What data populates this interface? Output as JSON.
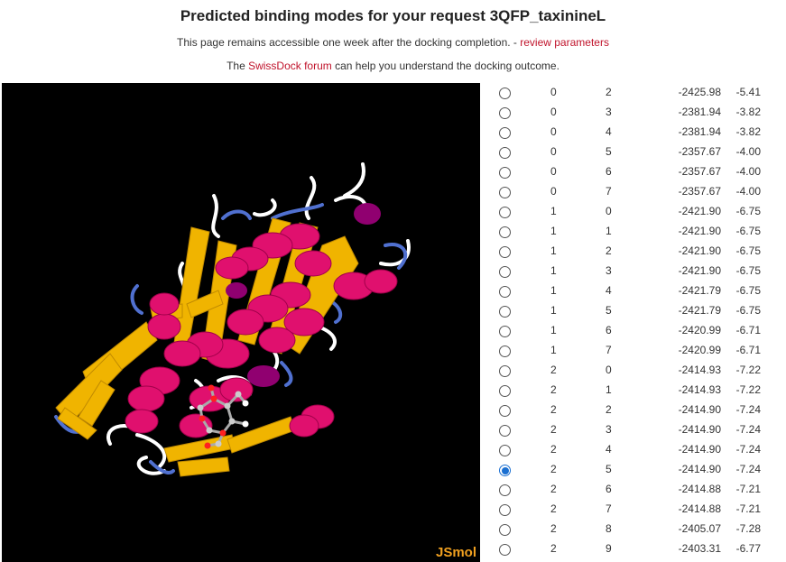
{
  "header": {
    "title": "Predicted binding modes for your request 3QFP_taxinineL",
    "line1_text": "This page remains accessible one week after the docking completion. - ",
    "line1_link": "review parameters",
    "line2_prefix": "The ",
    "line2_link": "SwissDock forum",
    "line2_suffix": " can help you understand the docking outcome."
  },
  "viewer": {
    "label": "JSmol",
    "label_color": "#f0a020",
    "background": "#000000"
  },
  "colors": {
    "link": "#c0132b",
    "helix": "#e0106e",
    "sheet": "#f0b400",
    "coil": "#ffffff",
    "turn": "#5070d0",
    "radio_checked": "#1a6fd1"
  },
  "results": [
    {
      "cluster": "0",
      "element": "2",
      "fitness": "-2425.98",
      "dg": "-5.41",
      "selected": false
    },
    {
      "cluster": "0",
      "element": "3",
      "fitness": "-2381.94",
      "dg": "-3.82",
      "selected": false
    },
    {
      "cluster": "0",
      "element": "4",
      "fitness": "-2381.94",
      "dg": "-3.82",
      "selected": false
    },
    {
      "cluster": "0",
      "element": "5",
      "fitness": "-2357.67",
      "dg": "-4.00",
      "selected": false
    },
    {
      "cluster": "0",
      "element": "6",
      "fitness": "-2357.67",
      "dg": "-4.00",
      "selected": false
    },
    {
      "cluster": "0",
      "element": "7",
      "fitness": "-2357.67",
      "dg": "-4.00",
      "selected": false
    },
    {
      "cluster": "1",
      "element": "0",
      "fitness": "-2421.90",
      "dg": "-6.75",
      "selected": false
    },
    {
      "cluster": "1",
      "element": "1",
      "fitness": "-2421.90",
      "dg": "-6.75",
      "selected": false
    },
    {
      "cluster": "1",
      "element": "2",
      "fitness": "-2421.90",
      "dg": "-6.75",
      "selected": false
    },
    {
      "cluster": "1",
      "element": "3",
      "fitness": "-2421.90",
      "dg": "-6.75",
      "selected": false
    },
    {
      "cluster": "1",
      "element": "4",
      "fitness": "-2421.79",
      "dg": "-6.75",
      "selected": false
    },
    {
      "cluster": "1",
      "element": "5",
      "fitness": "-2421.79",
      "dg": "-6.75",
      "selected": false
    },
    {
      "cluster": "1",
      "element": "6",
      "fitness": "-2420.99",
      "dg": "-6.71",
      "selected": false
    },
    {
      "cluster": "1",
      "element": "7",
      "fitness": "-2420.99",
      "dg": "-6.71",
      "selected": false
    },
    {
      "cluster": "2",
      "element": "0",
      "fitness": "-2414.93",
      "dg": "-7.22",
      "selected": false
    },
    {
      "cluster": "2",
      "element": "1",
      "fitness": "-2414.93",
      "dg": "-7.22",
      "selected": false
    },
    {
      "cluster": "2",
      "element": "2",
      "fitness": "-2414.90",
      "dg": "-7.24",
      "selected": false
    },
    {
      "cluster": "2",
      "element": "3",
      "fitness": "-2414.90",
      "dg": "-7.24",
      "selected": false
    },
    {
      "cluster": "2",
      "element": "4",
      "fitness": "-2414.90",
      "dg": "-7.24",
      "selected": false
    },
    {
      "cluster": "2",
      "element": "5",
      "fitness": "-2414.90",
      "dg": "-7.24",
      "selected": true
    },
    {
      "cluster": "2",
      "element": "6",
      "fitness": "-2414.88",
      "dg": "-7.21",
      "selected": false
    },
    {
      "cluster": "2",
      "element": "7",
      "fitness": "-2414.88",
      "dg": "-7.21",
      "selected": false
    },
    {
      "cluster": "2",
      "element": "8",
      "fitness": "-2405.07",
      "dg": "-7.28",
      "selected": false
    },
    {
      "cluster": "2",
      "element": "9",
      "fitness": "-2403.31",
      "dg": "-6.77",
      "selected": false
    }
  ]
}
